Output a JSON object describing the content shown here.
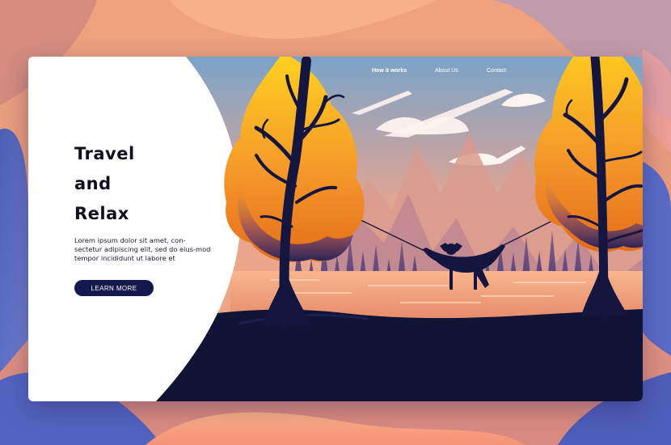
{
  "nav": {
    "items": [
      {
        "label": "How it works",
        "active": true
      },
      {
        "label": "About Us",
        "active": false
      },
      {
        "label": "Contact",
        "active": false
      }
    ]
  },
  "hero": {
    "title_lines": [
      "Travel",
      "and",
      "Relax"
    ],
    "body": "Lorem ipsum dolor sit amet, con-sectetur adipiscing elit, sed do eius-mod tempor incididunt ut labore et",
    "cta_label": "LEARN MORE"
  },
  "colors": {
    "accent_navy": "#13184d",
    "sky_top": "#7aa3c9",
    "sky_bottom": "#f2a880",
    "tree_top": "#ffd21f",
    "tree_bottom": "#f08a1c",
    "ground": "#101436"
  }
}
